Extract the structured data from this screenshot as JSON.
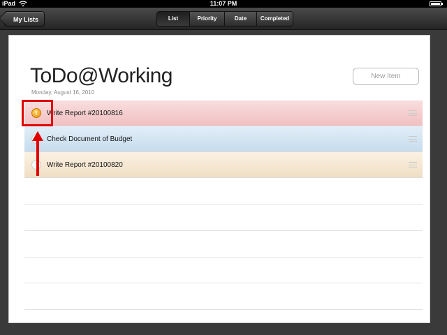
{
  "status_bar": {
    "carrier": "iPad",
    "time": "11:07 PM"
  },
  "toolbar": {
    "back_label": "My Lists",
    "segments": [
      {
        "label": "List",
        "selected": true
      },
      {
        "label": "Priority",
        "selected": false
      },
      {
        "label": "Date",
        "selected": false
      },
      {
        "label": "Completed",
        "selected": false
      }
    ]
  },
  "page": {
    "title": "ToDo@Working",
    "date": "Monday, August 16, 2010",
    "new_item_label": "New Item"
  },
  "tasks": [
    {
      "text": "Write Report #20100816",
      "color": "#f3c6c8",
      "priority_mark": "!"
    },
    {
      "text": "Check Document of Budget",
      "color": "#cde0ef"
    },
    {
      "text": "Write Report #20100820",
      "color": "#f2e2c9"
    }
  ],
  "annotation_color": "#e00000"
}
